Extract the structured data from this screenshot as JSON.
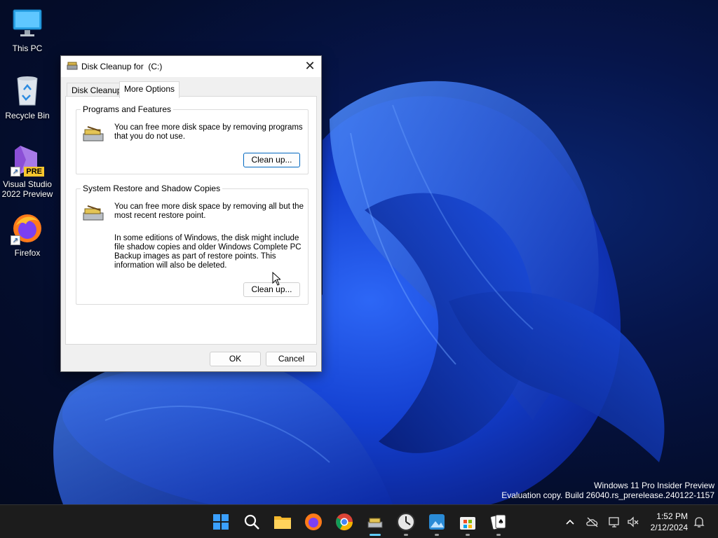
{
  "desktop": {
    "icons": [
      {
        "label": "This PC",
        "icon": "monitor-icon"
      },
      {
        "label": "Recycle Bin",
        "icon": "recycle-bin-icon"
      },
      {
        "label": "Visual Studio 2022 Preview",
        "icon": "visual-studio-icon",
        "badge": "PRE"
      },
      {
        "label": "Firefox",
        "icon": "firefox-icon"
      }
    ],
    "watermark": {
      "line1": "Windows 11 Pro Insider Preview",
      "line2": "Evaluation copy. Build 26040.rs_prerelease.240122-1157"
    }
  },
  "dialog": {
    "title": "Disk Cleanup for  (C:)",
    "tabs": [
      {
        "label": "Disk Cleanup",
        "active": false
      },
      {
        "label": "More Options",
        "active": true
      }
    ],
    "groups": [
      {
        "title": "Programs and Features",
        "text": "You can free more disk space by removing programs that you do not use.",
        "button": "Clean up..."
      },
      {
        "title": "System Restore and Shadow Copies",
        "text": "You can free more disk space by removing all but the most recent restore point.",
        "text2": "In some editions of Windows, the disk might include file shadow copies and older Windows Complete PC Backup images as part of restore points. This information will also be deleted.",
        "button": "Clean up..."
      }
    ],
    "ok_label": "OK",
    "cancel_label": "Cancel"
  },
  "taskbar": {
    "apps": [
      "start-icon",
      "search-icon",
      "file-explorer-icon",
      "firefox-icon",
      "chrome-icon",
      "disk-cleanup-icon",
      "clock-app-icon",
      "photos-icon",
      "store-icon",
      "solitaire-icon"
    ],
    "tray": [
      "chevron-up-icon",
      "onedrive-icon",
      "network-icon",
      "volume-muted-icon",
      "bell-icon"
    ],
    "time": "1:52 PM",
    "date": "2/12/2024"
  },
  "colors": {
    "accent": "#0067c0",
    "wallpaper": "#0a2570",
    "taskbar": "#1c1c1c",
    "indicator": "#60cdff"
  }
}
